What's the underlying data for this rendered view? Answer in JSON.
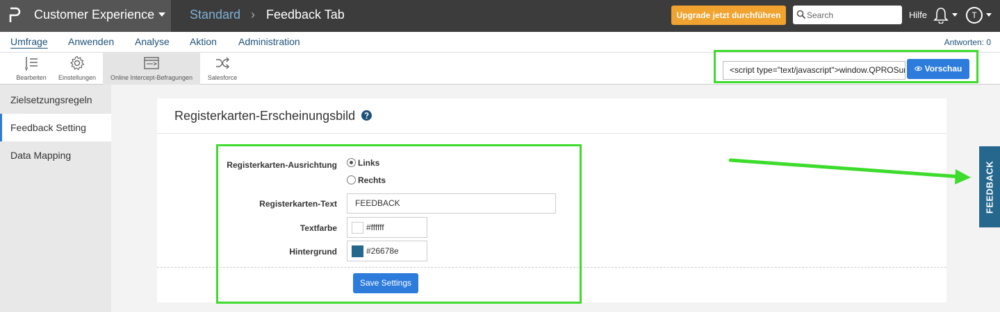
{
  "topbar": {
    "app_name": "Customer Experience",
    "breadcrumb_root": "Standard",
    "breadcrumb_separator": "›",
    "page_title": "Feedback Tab",
    "upgrade_label": "Upgrade jetzt durchführen",
    "search_placeholder": "Search",
    "help_label": "Hilfe",
    "avatar_initial": "T",
    "colors": {
      "bar": "#3c3c3c",
      "brand": "#555555",
      "upgrade": "#f0a32f",
      "breadcrumb_link": "#7fb0d6"
    }
  },
  "mainnav": {
    "items": [
      {
        "label": "Umfrage",
        "active": true
      },
      {
        "label": "Anwenden",
        "active": false
      },
      {
        "label": "Analyse",
        "active": false
      },
      {
        "label": "Aktion",
        "active": false
      },
      {
        "label": "Administration",
        "active": false
      }
    ],
    "responses_label": "Antworten: 0"
  },
  "toolbar": {
    "tools": [
      {
        "label": "Bearbeiten",
        "icon": "edit-list-icon",
        "active": false
      },
      {
        "label": "Einstellungen",
        "icon": "gear-icon",
        "active": false
      },
      {
        "label": "Online Intercept-Befragungen",
        "icon": "intercept-icon",
        "active": true
      },
      {
        "label": "Salesforce",
        "icon": "shuffle-icon",
        "active": false
      }
    ],
    "script_snippet": "<script type=\"text/javascript\">window.QPROSurvey...",
    "preview_label": "Vorschau"
  },
  "sidebar": {
    "items": [
      {
        "label": "Zielsetzungsregeln",
        "active": false
      },
      {
        "label": "Feedback Setting",
        "active": true
      },
      {
        "label": "Data Mapping",
        "active": false
      }
    ]
  },
  "panel": {
    "title": "Registerkarten-Erscheinungsbild",
    "form": {
      "alignment_label": "Registerkarten-Ausrichtung",
      "alignment_options": [
        {
          "label": "Links",
          "checked": true
        },
        {
          "label": "Rechts",
          "checked": false
        }
      ],
      "tab_text_label": "Registerkarten-Text",
      "tab_text_value": "FEEDBACK",
      "text_color_label": "Textfarbe",
      "text_color_value": "#ffffff",
      "background_label": "Hintergrund",
      "background_value": "#26678e",
      "save_label": "Save Settings"
    }
  },
  "feedback_tab": {
    "label": "FEEDBACK",
    "background": "#26678e"
  },
  "accent_color": "#2d7cdb",
  "highlight_color": "#3ddc2c"
}
